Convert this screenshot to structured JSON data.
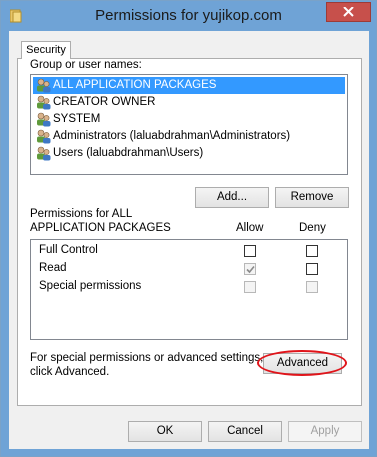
{
  "window": {
    "title": "Permissions for yujikop.com",
    "close_icon": "close-icon"
  },
  "tabs": [
    {
      "label": "Security"
    }
  ],
  "group_label": "Group or user names:",
  "users": [
    {
      "name": "ALL APPLICATION PACKAGES",
      "icon": "user-group-icon",
      "selected": true
    },
    {
      "name": "CREATOR OWNER",
      "icon": "user-group-icon",
      "selected": false
    },
    {
      "name": "SYSTEM",
      "icon": "user-group-icon",
      "selected": false
    },
    {
      "name": "Administrators (laluabdrahman\\Administrators)",
      "icon": "user-group-icon",
      "selected": false
    },
    {
      "name": "Users (laluabdrahman\\Users)",
      "icon": "user-group-icon",
      "selected": false
    }
  ],
  "add_button": "Add...",
  "remove_button": "Remove",
  "permissions_label_line1": "Permissions for ALL",
  "permissions_label_line2": "APPLICATION PACKAGES",
  "allow_header": "Allow",
  "deny_header": "Deny",
  "permissions": [
    {
      "name": "Full Control",
      "allow": false,
      "deny": false,
      "disabled": false
    },
    {
      "name": "Read",
      "allow": true,
      "deny": false,
      "disabled_allow": true
    },
    {
      "name": "Special permissions",
      "allow": false,
      "deny": false,
      "disabled": true
    }
  ],
  "advanced_text_line1": "For special permissions or advanced settings,",
  "advanced_text_line2": "click Advanced.",
  "advanced_button": "Advanced",
  "ok_button": "OK",
  "cancel_button": "Cancel",
  "apply_button": "Apply",
  "colors": {
    "titlebar": "#6fa3d6",
    "close": "#c7504b",
    "selection": "#3399ff",
    "annotation_circle": "#e0141a"
  }
}
